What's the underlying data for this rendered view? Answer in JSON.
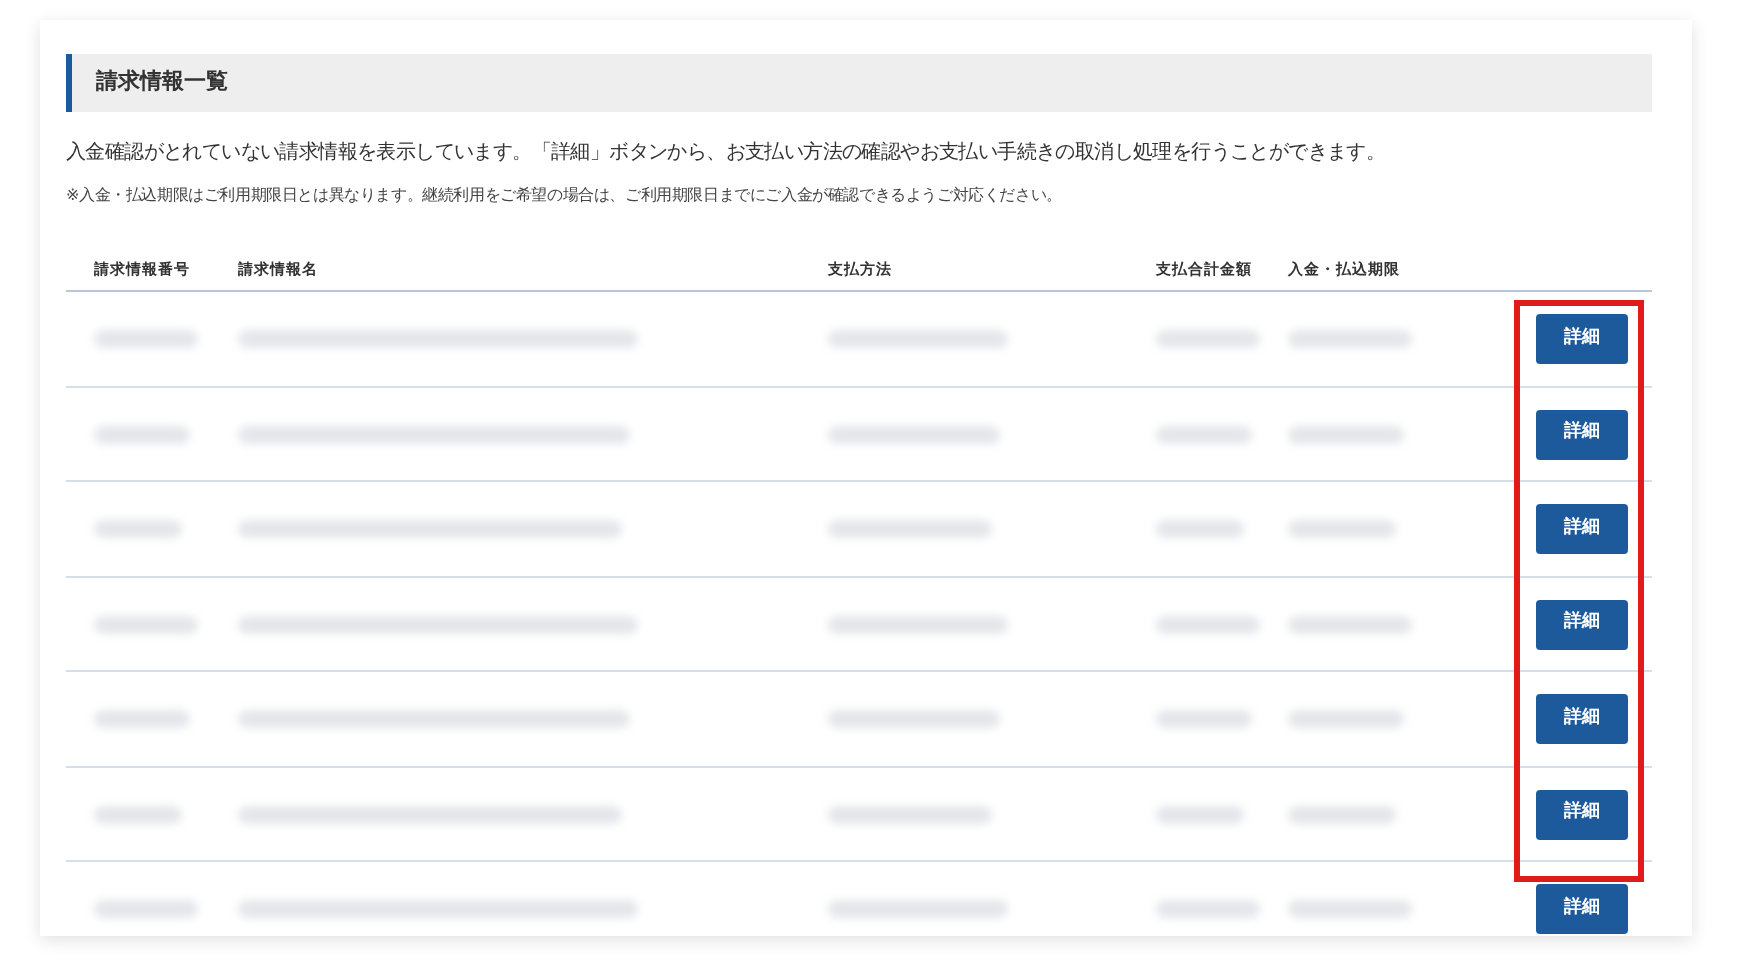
{
  "section": {
    "title": "請求情報一覧"
  },
  "description": "入金確認がとれていない請求情報を表示しています。「詳細」ボタンから、お支払い方法の確認やお支払い手続きの取消し処理を行うことができます。",
  "note": "※入金・払込期限はご利用期限日とは異なります。継続利用をご希望の場合は、ご利用期限日までにご入金が確認できるようご対応ください。",
  "table": {
    "columns": [
      "請求情報番号",
      "請求情報名",
      "支払方法",
      "支払合計金額",
      "入金・払込期限"
    ],
    "rows": [
      {
        "button": "詳細"
      },
      {
        "button": "詳細"
      },
      {
        "button": "詳細"
      },
      {
        "button": "詳細"
      },
      {
        "button": "詳細"
      },
      {
        "button": "詳細"
      },
      {
        "button": "詳細"
      }
    ]
  }
}
